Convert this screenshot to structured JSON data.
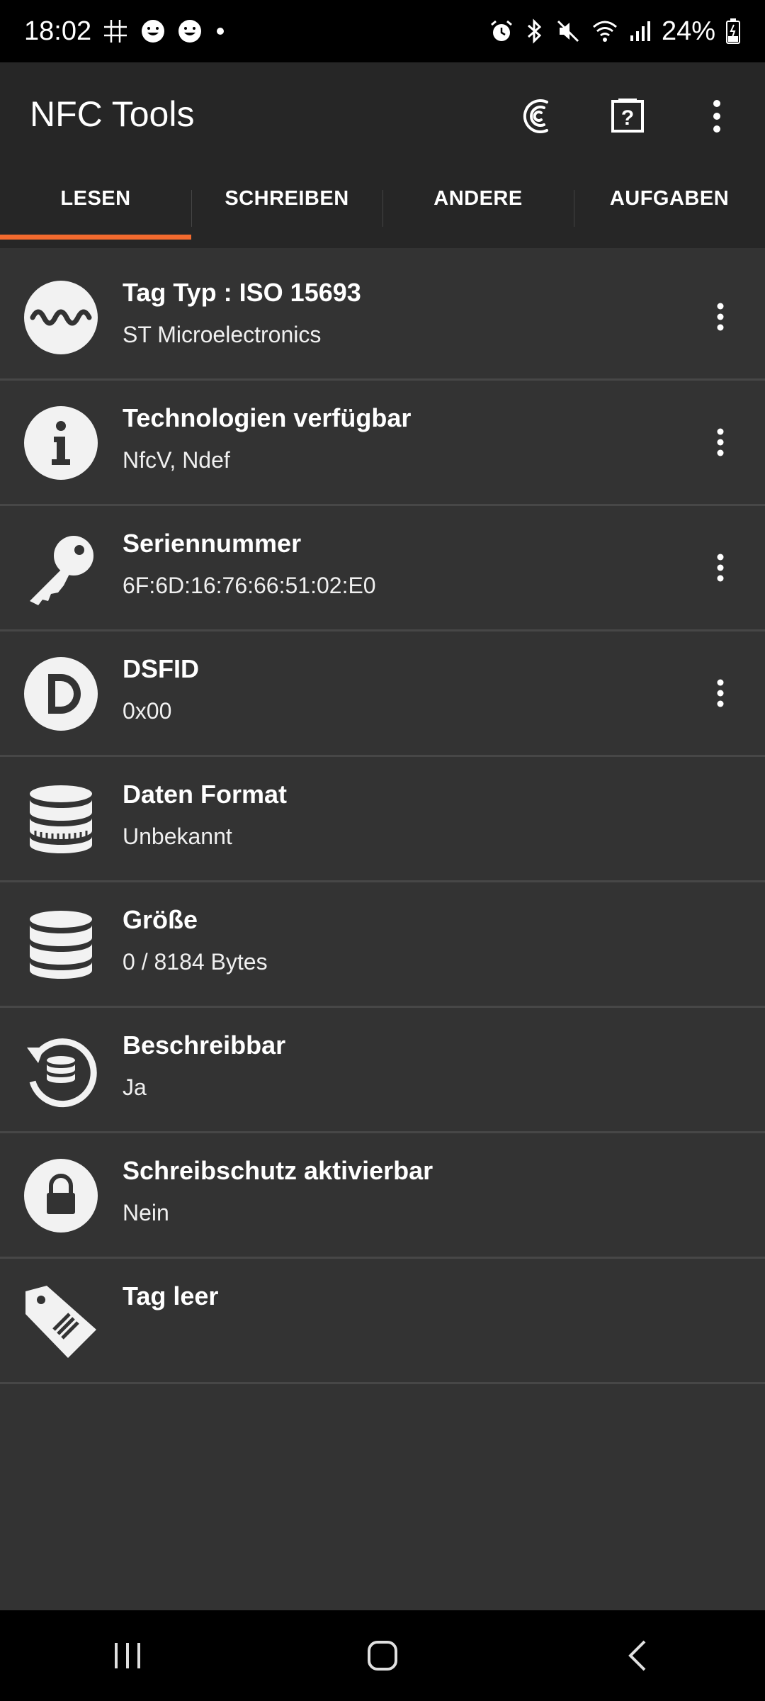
{
  "status_bar": {
    "time": "18:02",
    "battery": "24%",
    "icons": [
      "tic-tac-toe-icon",
      "emoji-icon",
      "emoji-icon",
      "dot-icon",
      "alarm-icon",
      "bluetooth-icon",
      "mute-icon",
      "wifi-icon",
      "signal-icon",
      "battery-icon"
    ]
  },
  "app_bar": {
    "title": "NFC Tools",
    "actions": [
      "nfc-scan-icon",
      "help-icon",
      "overflow-menu-icon"
    ]
  },
  "tabs": [
    {
      "label": "LESEN",
      "active": true
    },
    {
      "label": "SCHREIBEN",
      "active": false
    },
    {
      "label": "ANDERE",
      "active": false
    },
    {
      "label": "AUFGABEN",
      "active": false
    }
  ],
  "accent_color": "#f26a2e",
  "items": [
    {
      "title": "Tag Typ : ISO 15693",
      "value": "ST Microelectronics",
      "icon": "wave-icon",
      "has_menu": true
    },
    {
      "title": "Technologien verfügbar",
      "value": "NfcV, Ndef",
      "icon": "info-icon",
      "has_menu": true
    },
    {
      "title": "Seriennummer",
      "value": "6F:6D:16:76:66:51:02:E0",
      "icon": "key-icon",
      "has_menu": true
    },
    {
      "title": "DSFID",
      "value": "0x00",
      "icon": "letter-d-icon",
      "has_menu": true
    },
    {
      "title": "Daten Format",
      "value": "Unbekannt",
      "icon": "database-icon",
      "has_menu": false
    },
    {
      "title": "Größe",
      "value": "0 / 8184 Bytes",
      "icon": "database-icon",
      "has_menu": false
    },
    {
      "title": "Beschreibbar",
      "value": "Ja",
      "icon": "rewritable-icon",
      "has_menu": false
    },
    {
      "title": "Schreibschutz aktivierbar",
      "value": "Nein",
      "icon": "lock-icon",
      "has_menu": false
    },
    {
      "title": "Tag leer",
      "value": "",
      "icon": "tag-icon",
      "has_menu": false
    }
  ],
  "nav_bar": [
    "recents-button",
    "home-button",
    "back-button"
  ]
}
